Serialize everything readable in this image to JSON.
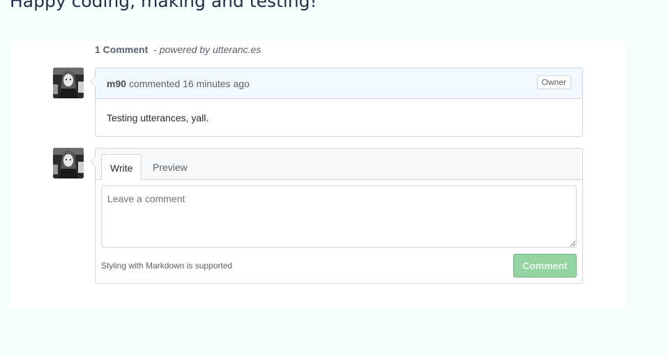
{
  "page": {
    "heading": "Happy coding, making and testing!"
  },
  "comments_section": {
    "count_label": "1 Comment",
    "separator": "-",
    "powered_by": "powered by utteranc.es"
  },
  "comment": {
    "author": "m90",
    "action_text": "commented 16 minutes ago",
    "badge": "Owner",
    "body": "Testing utterances, yall."
  },
  "compose": {
    "tabs": [
      {
        "label": "Write",
        "active": true
      },
      {
        "label": "Preview",
        "active": false
      }
    ],
    "placeholder": "Leave a comment",
    "value": "",
    "markdown_note": "Styling with Markdown is supported",
    "submit_label": "Comment"
  },
  "colors": {
    "page_bg": "#f5fffd",
    "header_bg": "#f1f8ff",
    "submit_disabled": "#94d3a2"
  },
  "icons": {
    "avatar": "user-avatar-photo"
  }
}
